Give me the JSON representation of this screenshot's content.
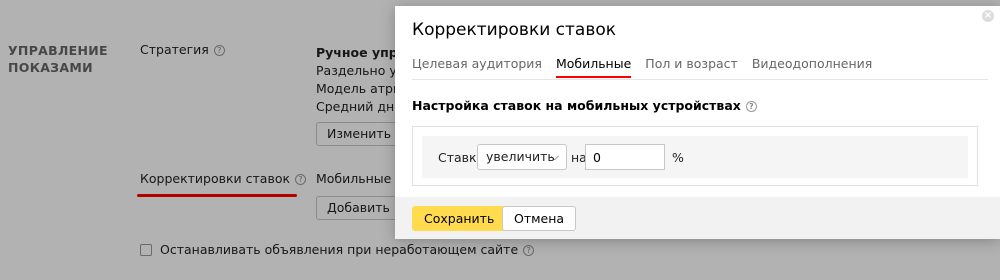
{
  "background": {
    "section_title": "УПРАВЛЕНИЕ ПОКАЗАМИ",
    "strategy_label": "Стратегия",
    "strategy_lines": [
      "Ручное управ",
      "Раздельно упр",
      "Модель атриб",
      "Средний днев"
    ],
    "change_button": "Изменить",
    "bid_adjustments_label": "Корректировки ставок",
    "mobile_value": "Мобильные",
    "add_button": "Добавить",
    "stop_ads_checkbox": "Останавливать объявления при неработающем сайте"
  },
  "modal": {
    "title": "Корректировки ставок",
    "tabs": [
      {
        "label": "Целевая аудитория",
        "active": false
      },
      {
        "label": "Мобильные",
        "active": true
      },
      {
        "label": "Пол и возраст",
        "active": false
      },
      {
        "label": "Видеодополнения",
        "active": false
      }
    ],
    "subheading": "Настройка ставок на мобильных устройствах",
    "rate_label": "Ставка",
    "direction_select": "увеличить",
    "on_label": "на",
    "value_input": "0",
    "percent_sign": "%",
    "save_button": "Сохранить",
    "cancel_button": "Отмена"
  },
  "colors": {
    "accent_yellow": "#ffdb4d",
    "tab_underline": "#ff0000",
    "annotation_red": "#ff0000"
  }
}
